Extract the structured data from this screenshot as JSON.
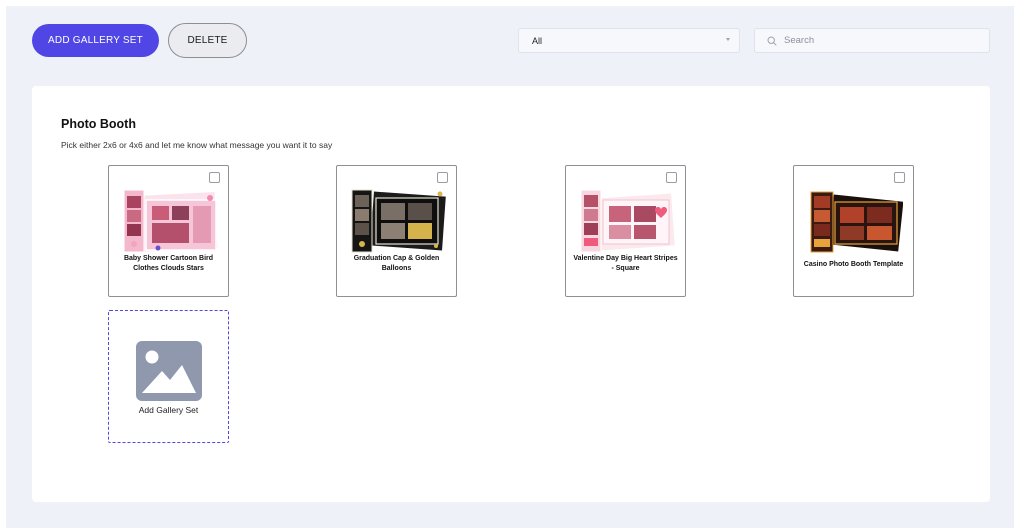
{
  "toolbar": {
    "add_label": "ADD GALLERY SET",
    "delete_label": "DELETE"
  },
  "filter": {
    "selected": "All"
  },
  "search": {
    "placeholder": "Search"
  },
  "section": {
    "title": "Photo Booth",
    "subtitle": "Pick either 2x6 or 4x6 and let me know what message you want it to say"
  },
  "gallery": {
    "items": [
      {
        "label": "Baby Shower Cartoon Bird Clothes Clouds Stars",
        "theme": "pink"
      },
      {
        "label": "Graduation Cap & Golden Balloons",
        "theme": "black-gold"
      },
      {
        "label": "Valentine Day Big Heart Stripes - Square",
        "theme": "pink-stripes"
      },
      {
        "label": "Casino Photo Booth Template",
        "theme": "red-black"
      }
    ],
    "add_label": "Add Gallery Set"
  },
  "colors": {
    "accent": "#4f46e5",
    "background": "#eff1f9",
    "placeholder": "#8f98ad"
  }
}
